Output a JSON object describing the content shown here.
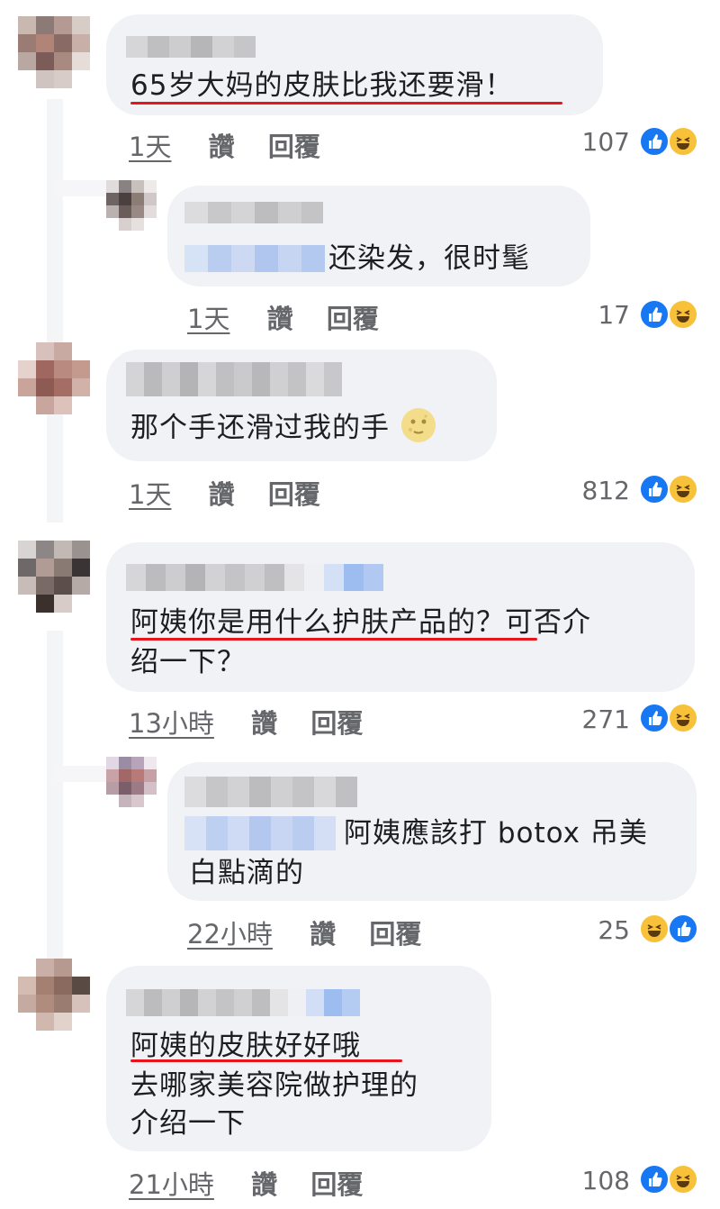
{
  "comments": [
    {
      "text": "65岁大妈的皮肤比我还要滑！",
      "time": "1天",
      "like_label": "讚",
      "reply_label": "回覆",
      "count": "107"
    },
    {
      "text": "还染发，很时髦",
      "time": "1天",
      "like_label": "讚",
      "reply_label": "回覆",
      "count": "17"
    },
    {
      "text": "那个手还滑过我的手",
      "time": "1天",
      "like_label": "讚",
      "reply_label": "回覆",
      "count": "812"
    },
    {
      "text_line1": "阿姨你是用什么护肤产品的？可否介",
      "text_line2": "绍一下？",
      "time": "13小時",
      "like_label": "讚",
      "reply_label": "回覆",
      "count": "271"
    },
    {
      "text_line1": "阿姨應該打 botox 吊美",
      "text_line2": "白點滴的",
      "time": "22小時",
      "like_label": "讚",
      "reply_label": "回覆",
      "count": "25"
    },
    {
      "text_line1": "阿姨的皮肤好好哦",
      "text_line2": "去哪家美容院做护理的",
      "text_line3": "介绍一下",
      "time": "21小時",
      "like_label": "讚",
      "reply_label": "回覆",
      "count": "108"
    }
  ],
  "colors": {
    "accent_underline": "#e8141b",
    "like": "#1877f2",
    "haha": "#f7c23a",
    "bubble": "#f0f2f5"
  },
  "icons": {
    "like": "thumbs-up-icon",
    "haha": "laughing-face-icon",
    "emoji": "moon-face-emoji"
  }
}
